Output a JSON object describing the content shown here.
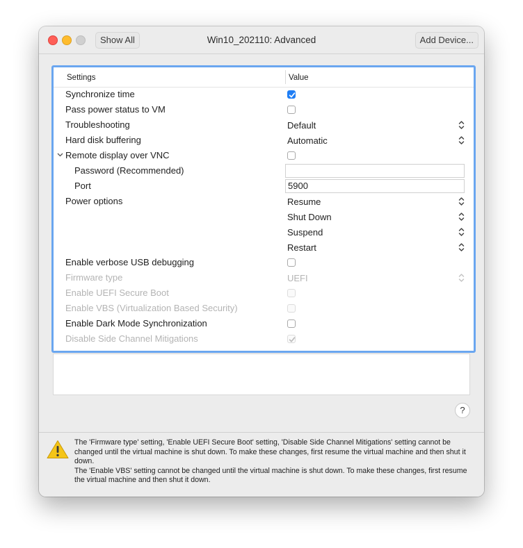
{
  "window": {
    "title": "Win10_202110: Advanced",
    "show_all": "Show All",
    "add_device": "Add Device..."
  },
  "table": {
    "headers": {
      "settings": "Settings",
      "value": "Value"
    },
    "rows": [
      {
        "label": "Synchronize time",
        "type": "checkbox",
        "checked": true,
        "disabled": false
      },
      {
        "label": "Pass power status to VM",
        "type": "checkbox",
        "checked": false,
        "disabled": false
      },
      {
        "label": "Troubleshooting",
        "type": "popup",
        "value": "Default",
        "disabled": false
      },
      {
        "label": "Hard disk buffering",
        "type": "popup",
        "value": "Automatic",
        "disabled": false
      },
      {
        "label": "Remote display over VNC",
        "type": "checkbox",
        "checked": false,
        "disabled": false,
        "expanded": true
      },
      {
        "label": "Password (Recommended)",
        "type": "text",
        "value": "",
        "indent": true
      },
      {
        "label": "Port",
        "type": "text",
        "value": "5900",
        "indent": true
      },
      {
        "label": "Power options",
        "type": "popup",
        "value": "Resume",
        "disabled": false
      },
      {
        "label": "",
        "type": "popup",
        "value": "Shut Down",
        "disabled": false
      },
      {
        "label": "",
        "type": "popup",
        "value": "Suspend",
        "disabled": false
      },
      {
        "label": "",
        "type": "popup",
        "value": "Restart",
        "disabled": false
      },
      {
        "label": "Enable verbose USB debugging",
        "type": "checkbox",
        "checked": false,
        "disabled": false
      },
      {
        "label": "Firmware type",
        "type": "popup",
        "value": "UEFI",
        "disabled": true
      },
      {
        "label": "Enable UEFI Secure Boot",
        "type": "checkbox",
        "checked": false,
        "disabled": true
      },
      {
        "label": "Enable VBS (Virtualization Based Security)",
        "type": "checkbox",
        "checked": false,
        "disabled": true
      },
      {
        "label": "Enable Dark Mode Synchronization",
        "type": "checkbox",
        "checked": false,
        "disabled": false
      },
      {
        "label": "Disable Side Channel Mitigations",
        "type": "checkbox",
        "checked": true,
        "disabled": true
      }
    ]
  },
  "help_label": "?",
  "icons": {
    "warning": "warning-icon",
    "help": "help-icon",
    "chevron": "chevron-down-icon",
    "stepper": "updown-chevron-icon"
  },
  "colors": {
    "accent": "#1f7ef5",
    "focus_ring": "#6aa6f0",
    "warning": "#f5c518"
  },
  "warning": {
    "line1": "The 'Firmware type' setting, 'Enable UEFI Secure Boot' setting, 'Disable Side Channel Mitigations' setting cannot be changed until the virtual machine is shut down. To make these changes, first resume the virtual machine and then shut it down.",
    "line2": "The 'Enable VBS' setting cannot be changed until the virtual machine is shut down. To make these changes, first resume the virtual machine and then shut it down."
  }
}
